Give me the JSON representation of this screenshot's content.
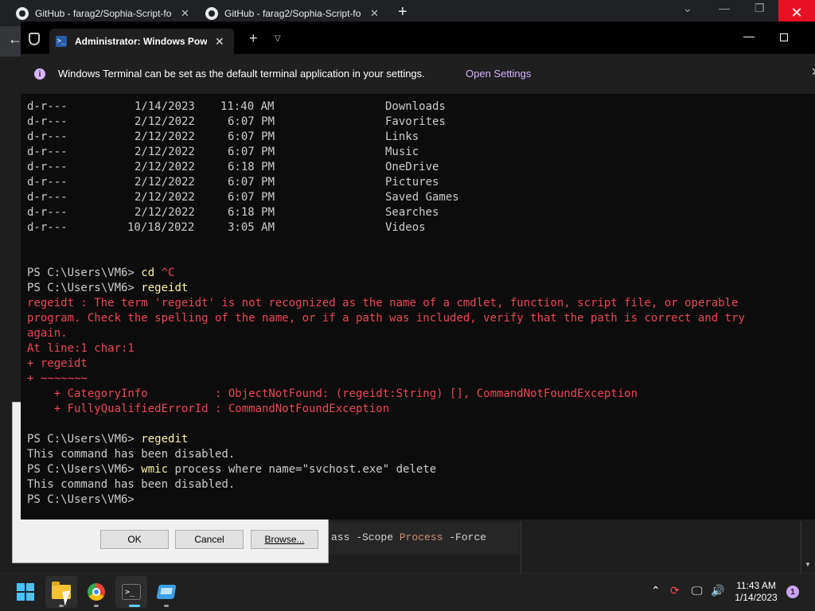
{
  "browser": {
    "tabs": [
      {
        "label": "GitHub - farag2/Sophia-Script-fo"
      },
      {
        "label": "GitHub - farag2/Sophia-Script-fo"
      }
    ],
    "new_tab": "+",
    "close_glyph": "✕"
  },
  "dialog": {
    "ok_label": "OK",
    "cancel_label": "Cancel",
    "browse_label": "Browse..."
  },
  "editor": {
    "line_prefix": "ass -Scope ",
    "line_keyword": "Process",
    "line_suffix": " -Force"
  },
  "terminal": {
    "tab_title": "Administrator: Windows Powe",
    "infobar": {
      "message": "Windows Terminal can be set as the default terminal application in your settings.",
      "link": "Open Settings"
    },
    "dir_listing": [
      {
        "mode": "d-r---",
        "date": "1/14/2023",
        "time": "11:40 AM",
        "name": "Downloads"
      },
      {
        "mode": "d-r---",
        "date": "2/12/2022",
        "time": "6:07 PM",
        "name": "Favorites"
      },
      {
        "mode": "d-r---",
        "date": "2/12/2022",
        "time": "6:07 PM",
        "name": "Links"
      },
      {
        "mode": "d-r---",
        "date": "2/12/2022",
        "time": "6:07 PM",
        "name": "Music"
      },
      {
        "mode": "d-r---",
        "date": "2/12/2022",
        "time": "6:18 PM",
        "name": "OneDrive"
      },
      {
        "mode": "d-r---",
        "date": "2/12/2022",
        "time": "6:07 PM",
        "name": "Pictures"
      },
      {
        "mode": "d-r---",
        "date": "2/12/2022",
        "time": "6:07 PM",
        "name": "Saved Games"
      },
      {
        "mode": "d-r---",
        "date": "2/12/2022",
        "time": "6:18 PM",
        "name": "Searches"
      },
      {
        "mode": "d-r---",
        "date": "10/18/2022",
        "time": "3:05 AM",
        "name": "Videos"
      }
    ],
    "prompt": "PS C:\\Users\\VM6> ",
    "cmd1": "cd",
    "cmd1_arg": " ^C",
    "cmd2": "regeidt",
    "err_lines": [
      "regeidt : The term 'regeidt' is not recognized as the name of a cmdlet, function, script file, or operable",
      "program. Check the spelling of the name, or if a path was included, verify that the path is correct and try",
      "again.",
      "At line:1 char:1",
      "+ regeidt",
      "+ ~~~~~~~",
      "    + CategoryInfo          : ObjectNotFound: (regeidt:String) [], CommandNotFoundException",
      "    + FullyQualifiedErrorId : CommandNotFoundException"
    ],
    "cmd3": "regedit",
    "disabled_msg": "This command has been disabled.",
    "cmd4": "wmic",
    "cmd4_args": " process where name=\"svchost.exe\" delete"
  },
  "taskbar": {
    "time": "11:43 AM",
    "date": "1/14/2023",
    "notification_count": "1",
    "icons": [
      "windows-start-icon",
      "file-explorer-icon",
      "chrome-icon",
      "terminal-icon",
      "sandbox-icon"
    ]
  }
}
